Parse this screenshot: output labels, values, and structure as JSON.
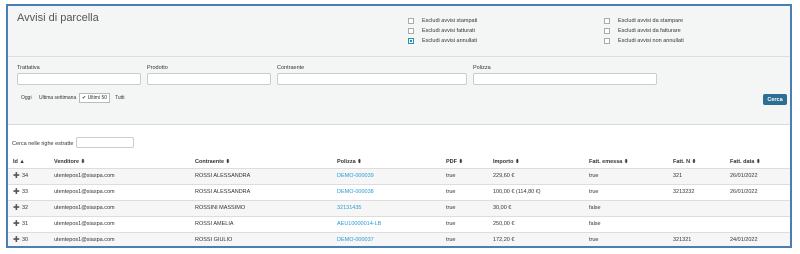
{
  "title": "Avvisi di parcella",
  "checkboxes": [
    {
      "label": "Escludi avvisi stampati",
      "checked": false
    },
    {
      "label": "Escludi avvisi fatturati",
      "checked": false
    },
    {
      "label": "Escludi avvisi annullati",
      "checked": true
    },
    {
      "label": "Escludi avvisi da stampare",
      "checked": false
    },
    {
      "label": "Escludi avvisi da fatturare",
      "checked": false
    },
    {
      "label": "Escludi avvisi non annullati",
      "checked": false
    }
  ],
  "filters": {
    "trattativa": "Trattativa",
    "prodotto": "Prodotto",
    "contraente": "Contraente",
    "polizza": "Polizza"
  },
  "ranges": [
    "Oggi",
    "Ultima settimana",
    "✔ Ultimi 50",
    "Tutti"
  ],
  "search_button": "Cerca",
  "row_search_label": "Cerca nelle righe estratte",
  "columns": [
    "Id ▲",
    "Venditore ⬍",
    "Contraente ⬍",
    "Polizza ⬍",
    "PDF ⬍",
    "Importo ⬍",
    "Fatt. emessa ⬍",
    "Fatt. N ⬍",
    "Fatt. data ⬍"
  ],
  "rows": [
    {
      "id": "34",
      "venditore": "utentepos1@siaspa.com",
      "contraente": "ROSSI ALESSANDRA",
      "polizza": "DEMO-000039",
      "pdf": "true",
      "importo": "229,60 €",
      "emessa": "true",
      "n": "321",
      "data": "26/01/2022"
    },
    {
      "id": "33",
      "venditore": "utentepos1@siaspa.com",
      "contraente": "ROSSI ALESSANDRA",
      "polizza": "DEMO-000038",
      "pdf": "true",
      "importo": "100,00 € (114,80 €)",
      "emessa": "true",
      "n": "3213232",
      "data": "26/01/2022"
    },
    {
      "id": "32",
      "venditore": "utentepos1@siaspa.com",
      "contraente": "ROSSINI MASSIMO",
      "polizza": "32131435",
      "pdf": "true",
      "importo": "30,00 €",
      "emessa": "false",
      "n": "",
      "data": ""
    },
    {
      "id": "31",
      "venditore": "utentepos1@siaspa.com",
      "contraente": "ROSSI AMELIA",
      "polizza": "AEU10000014-LB",
      "pdf": "true",
      "importo": "250,00 €",
      "emessa": "false",
      "n": "",
      "data": ""
    },
    {
      "id": "30",
      "venditore": "utentepos1@siaspa.com",
      "contraente": "ROSSI GIULIO",
      "polizza": "DEMO-000037",
      "pdf": "true",
      "importo": "172,20 €",
      "emessa": "true",
      "n": "321321",
      "data": "24/01/2022"
    }
  ]
}
